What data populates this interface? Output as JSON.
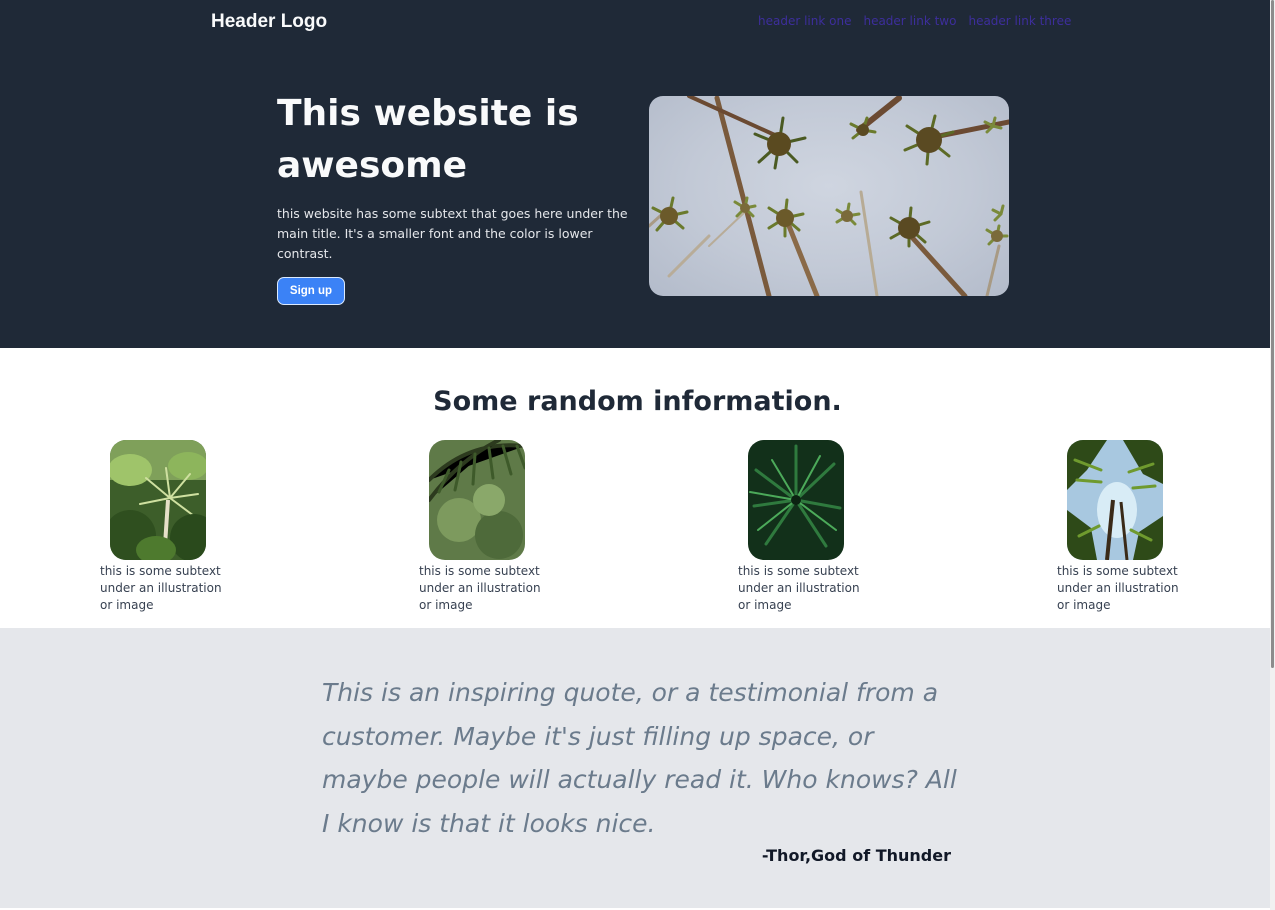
{
  "header": {
    "logo": "Header Logo",
    "links": [
      "header link one",
      "header link two",
      "header link three"
    ]
  },
  "hero": {
    "title": "This website is awesome",
    "subtext": "this website has some subtext that goes here under the main title. It's a smaller font and the color is lower contrast.",
    "signup_label": "Sign up",
    "image": "palm-trees-from-below"
  },
  "info": {
    "title": "Some random information.",
    "cards": [
      {
        "caption": "this is some subtext under an illustration or image",
        "image": "jungle-palm"
      },
      {
        "caption": "this is some subtext under an illustration or image",
        "image": "palm-leaf-blur"
      },
      {
        "caption": "this is some subtext under an illustration or image",
        "image": "green-palm-fronds"
      },
      {
        "caption": "this is some subtext under an illustration or image",
        "image": "palm-canopy-sky"
      }
    ]
  },
  "quote": {
    "text": "This is an inspiring quote, or a testimonial from a customer. Maybe it's just filling up space, or maybe people will actually read it. Who knows? All I know is that it looks nice.",
    "author": "-Thor,God of Thunder"
  },
  "colors": {
    "header_bg": "#1f2937",
    "accent": "#3b82f6",
    "quote_bg": "#e5e7eb",
    "quote_text": "#6b7b8c",
    "link": "#3d2e9c"
  }
}
